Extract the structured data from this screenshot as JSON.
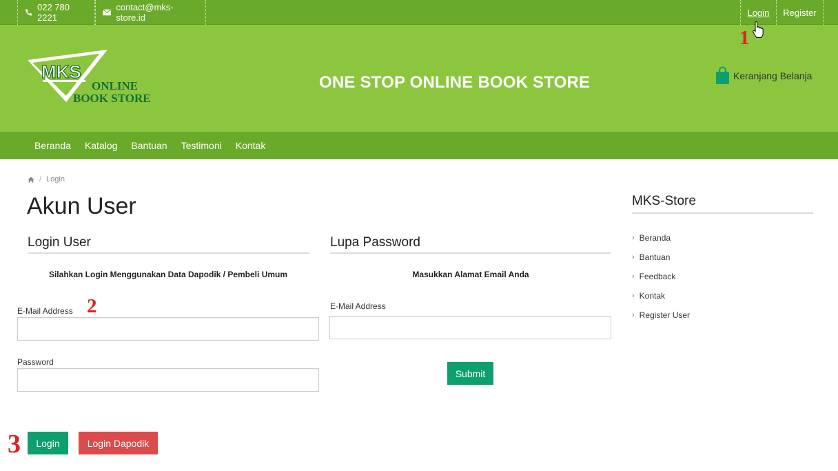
{
  "topbar": {
    "phone": "022 780 2221",
    "email": "contact@mks-store.id",
    "login": "Login",
    "register": "Register"
  },
  "header": {
    "logo_mark": "MKS",
    "logo_line1": "ONLINE",
    "logo_line2": "BOOK STORE",
    "tagline": "ONE STOP ONLINE BOOK STORE",
    "cart_label": "Keranjang Belanja"
  },
  "nav": {
    "items": [
      "Beranda",
      "Katalog",
      "Bantuan",
      "Testimoni",
      "Kontak"
    ]
  },
  "breadcrumb": {
    "current": "Login"
  },
  "page": {
    "title": "Akun User"
  },
  "login_panel": {
    "title": "Login User",
    "subtitle": "Silahkan Login Menggunakan Data Dapodik / Pembeli Umum",
    "email_label": "E-Mail Address",
    "email_value": "",
    "password_label": "Password",
    "password_value": "",
    "login_button": "Login",
    "dapodik_button": "Login Dapodik"
  },
  "forgot_panel": {
    "title": "Lupa Password",
    "subtitle": "Masukkan Alamat Email Anda",
    "email_label": "E-Mail Address",
    "email_value": "",
    "submit_button": "Submit"
  },
  "sidebar": {
    "title": "MKS-Store",
    "items": [
      "Beranda",
      "Bantuan",
      "Feedback",
      "Kontak",
      "Register User"
    ]
  },
  "annotations": [
    "1",
    "2",
    "3"
  ],
  "colors": {
    "topbar": "#6aaa2a",
    "header": "#8cc63f",
    "primary_button": "#0e9f6e",
    "danger_button": "#db4b4b",
    "annotation": "#e02020"
  }
}
